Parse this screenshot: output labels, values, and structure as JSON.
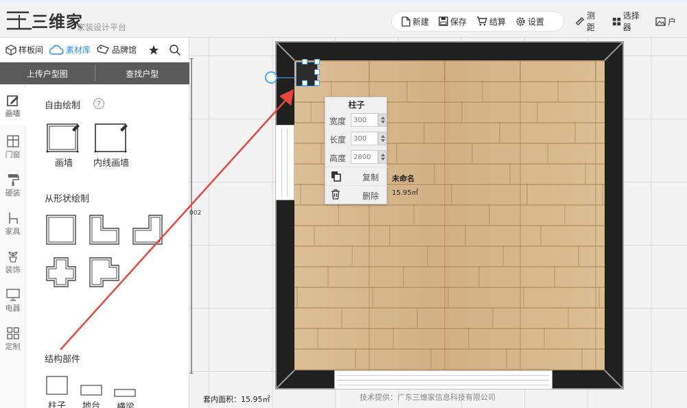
{
  "header": {
    "brand": "三维家",
    "slogan": "家装设计平台",
    "toolbar": [
      {
        "label": "新建",
        "icon": "new-file-icon"
      },
      {
        "label": "保存",
        "icon": "save-icon"
      },
      {
        "label": "结算",
        "icon": "cart-icon"
      },
      {
        "label": "设置",
        "icon": "gear-icon"
      }
    ],
    "tools": [
      {
        "label": "测距",
        "icon": "ruler-icon"
      },
      {
        "label": "选择器",
        "icon": "grid-selector-icon"
      },
      {
        "label": "户",
        "icon": "picture-icon"
      }
    ]
  },
  "library_tabs": [
    {
      "label": "样板间",
      "icon": "cube-icon"
    },
    {
      "label": "素材库",
      "icon": "cloud-icon",
      "active": true
    },
    {
      "label": "品牌馆",
      "icon": "tag-icon"
    }
  ],
  "upload_bar": {
    "upload": "上传户型图",
    "find": "查找户型"
  },
  "categories": [
    {
      "label": "画墙",
      "icon": "pencil-icon",
      "active": true
    },
    {
      "label": "门窗",
      "icon": "window-icon"
    },
    {
      "label": "硬装",
      "icon": "paint-roller-icon"
    },
    {
      "label": "家具",
      "icon": "chair-icon"
    },
    {
      "label": "装饰",
      "icon": "plant-icon"
    },
    {
      "label": "电器",
      "icon": "monitor-icon"
    },
    {
      "label": "定制",
      "icon": "grid-icon"
    }
  ],
  "draw": {
    "free_title": "自由绘制",
    "help": "?",
    "draw_wall": "画墙",
    "inner_wall": "内线画墙",
    "shape_title": "从形状绘制",
    "struct_title": "结构部件",
    "pillar": "柱子",
    "platform": "地台",
    "beam": "横梁"
  },
  "ruler_label": "002",
  "room": {
    "name": "未命名",
    "area": "15.95㎡"
  },
  "popup": {
    "title": "柱子",
    "width_label": "宽度",
    "width_value": "300",
    "length_label": "长度",
    "length_value": "300",
    "height_label": "高度",
    "height_value": "2800",
    "copy": "复制",
    "delete": "删除"
  },
  "footer": {
    "area": "套内面积：15.95㎡",
    "credit": "技术提供：广东三维家信息科技有限公司"
  },
  "colors": {
    "accent": "#2a8ee8",
    "selection": "#49a7f5",
    "annotation_arrow": "#e8463c"
  }
}
